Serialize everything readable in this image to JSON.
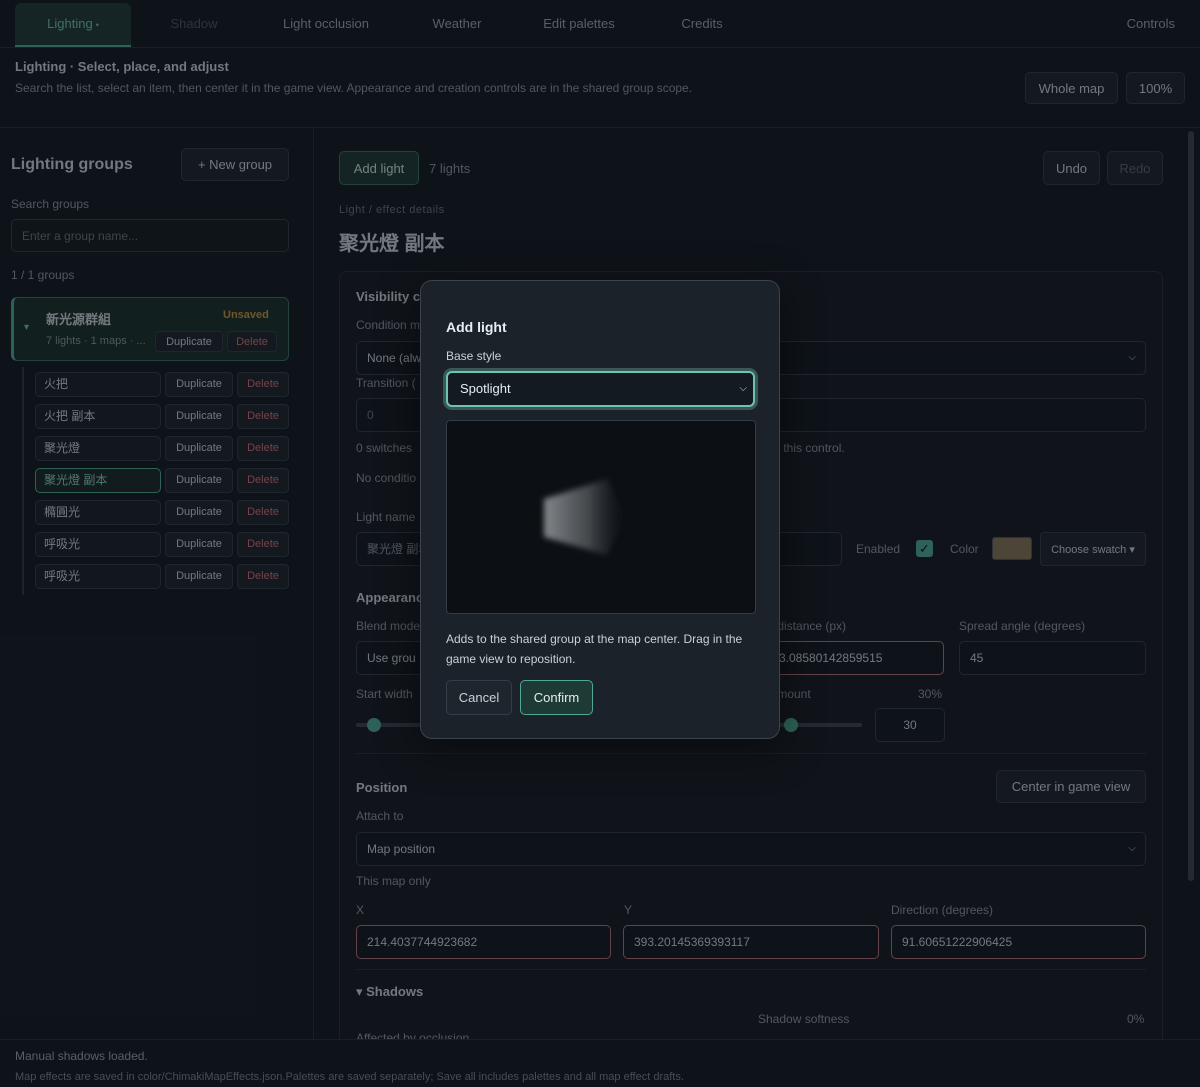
{
  "tabs": [
    {
      "label": "Lighting",
      "dot": "•",
      "state": "active"
    },
    {
      "label": "Shadow",
      "state": "disabled"
    },
    {
      "label": "Light occlusion",
      "state": "normal"
    },
    {
      "label": "Weather",
      "state": "normal"
    },
    {
      "label": "Edit palettes",
      "state": "normal"
    },
    {
      "label": "Credits",
      "state": "normal"
    }
  ],
  "controls_label": "Controls",
  "subheader": {
    "title": "Lighting · Select, place, and adjust",
    "description": "Search the list, select an item, then center it in the game view. Appearance and creation controls are in the shared group scope.",
    "whole_map": "Whole map",
    "zoom": "100%"
  },
  "sidebar": {
    "title": "Lighting groups",
    "new_group": "+ New group",
    "search_label": "Search groups",
    "search_placeholder": "Enter a group name...",
    "count": "1 / 1 groups",
    "group": {
      "name": "新光源群組",
      "badge": "Unsaved",
      "meta": "7 lights · 1 maps · ...",
      "duplicate": "Duplicate",
      "delete": "Delete",
      "caret": "▾"
    },
    "lights": [
      {
        "name": "火把",
        "selected": false
      },
      {
        "name": "火把 副本",
        "selected": false
      },
      {
        "name": "聚光燈",
        "selected": false
      },
      {
        "name": "聚光燈 副本",
        "selected": true
      },
      {
        "name": "橢圓光",
        "selected": false
      },
      {
        "name": "呼吸光",
        "selected": false
      },
      {
        "name": "呼吸光",
        "selected": false
      }
    ],
    "duplicate_label": "Duplicate",
    "delete_label": "Delete"
  },
  "main": {
    "add_light": "Add light",
    "light_count": "7 lights",
    "undo": "Undo",
    "redo": "Redo",
    "details_caption": "Light / effect details",
    "light_title": "聚光燈 副本",
    "visibility_title": "Visibility c",
    "condition_label": "Condition m",
    "condition_value": "None (alw",
    "transition_label": "Transition (",
    "transition_value": "0",
    "switches_text": "0 switches",
    "switches_hint": "ble this control.",
    "no_condition": "No conditio",
    "light_name_label": "Light name",
    "light_name_value": "聚光燈 副本",
    "enabled_label": "Enabled",
    "color_label": "Color",
    "color_value": "#857558",
    "choose_swatch": "Choose swatch ▾",
    "appearance_title": "Appearanc",
    "blend_label": "Blend mode",
    "blend_value": "Use grou",
    "distance_label": "nt distance (px)",
    "distance_value": "3.08580142859515",
    "spread_label": "Spread angle (degrees)",
    "spread_value": "45",
    "start_width_label": "Start width",
    "amount_label": "t amount",
    "amount_pct": "30%",
    "amount_value": "30",
    "position_title": "Position",
    "center_btn": "Center in game view",
    "attach_label": "Attach to",
    "attach_value": "Map position",
    "map_only": "This map only",
    "x_label": "X",
    "x_value": "214.4037744923682",
    "y_label": "Y",
    "y_value": "393.20145369393117",
    "dir_label": "Direction (degrees)",
    "dir_value": "91.60651222906425",
    "shadows_title": "▾ Shadows",
    "occlusion_label": "Affected by occlusion",
    "softness_label": "Shadow softness",
    "softness_pct": "0%"
  },
  "modal": {
    "title": "Add light",
    "base_style_label": "Base style",
    "base_style_value": "Spotlight",
    "hint": "Adds to the shared group at the map center. Drag in the game view to reposition.",
    "cancel": "Cancel",
    "confirm": "Confirm"
  },
  "footer": {
    "status": "Manual shadows loaded.",
    "note": "Map effects are saved in color/ChimakiMapEffects.json.Palettes are saved separately; Save all includes palettes and all map effect drafts."
  },
  "colors": {
    "accent": "#4ea896",
    "background": "#131a21",
    "danger": "#d0707a",
    "warning_badge": "#c9923f"
  }
}
